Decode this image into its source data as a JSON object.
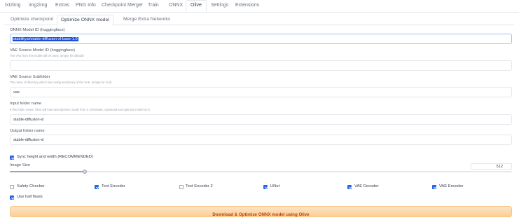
{
  "topnav": {
    "tabs": [
      "txt2img",
      "img2img",
      "Extras",
      "PNG Info",
      "Checkpoint Merger",
      "Train",
      "ONNX",
      "Olive",
      "Settings",
      "Extensions"
    ],
    "active": "Olive"
  },
  "subnav": {
    "tabs": [
      "Optimize checkpoint",
      "Optimize ONNX model",
      "Merge Extra Networks"
    ],
    "active": "Optimize ONNX model"
  },
  "form": {
    "onnx_model_id": {
      "label": "ONNX Model ID (huggingface)",
      "value": "stabilityai/stable-diffusion-xl-base-1.0"
    },
    "vae_source_model_id": {
      "label": "VAE Source Model ID (huggingface)",
      "hint": "The VAE from this model will be used. (empty for default)",
      "value": ""
    },
    "vae_source_subfolder": {
      "label": "VAE Source Subfolder",
      "hint": "The name of directory which has config and binary of the VAE. (empty for root)",
      "value": "vae"
    },
    "input_folder": {
      "label": "Input folder name",
      "hint": "If this folder exists, Olive will load and optimize model from it. Otherwise, download and optimize model on it.",
      "value": "stable-diffusion-xl"
    },
    "output_folder": {
      "label": "Output folder name",
      "value": "stable-diffusion-xl"
    },
    "sync_hw": {
      "label": "Sync height and width (RECOMMENDED)",
      "checked": true
    },
    "image_size": {
      "label": "Image Size",
      "value": "512",
      "fraction": 0.149
    },
    "components": [
      {
        "label": "Safety Checker",
        "checked": false
      },
      {
        "label": "Text Encoder",
        "checked": true
      },
      {
        "label": "Text Encoder 2",
        "checked": false
      },
      {
        "label": "UNet",
        "checked": true
      },
      {
        "label": "VAE Decoder",
        "checked": true
      },
      {
        "label": "VAE Encoder",
        "checked": true
      }
    ],
    "half_floats": {
      "label": "Use half floats",
      "checked": true
    }
  },
  "run_button": {
    "label": "Download & Optimize ONNX model using Olive"
  },
  "colors": {
    "accent": "#2563eb",
    "button_text": "#c2410c",
    "button_bg": "#fbcf95"
  }
}
